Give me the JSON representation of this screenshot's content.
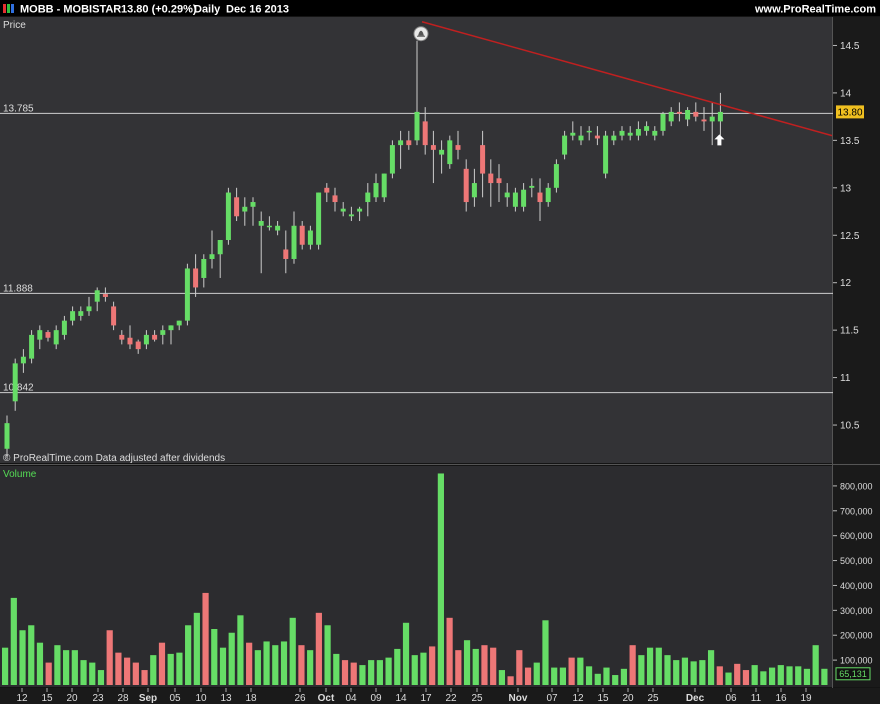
{
  "header": {
    "symbol": "MOBB - MOBISTAR",
    "quote": "13.80 (+0.29%)",
    "period": "Daily",
    "date": "Dec 16 2013",
    "site": "www.ProRealTime.com"
  },
  "price_panel": {
    "label": "Price",
    "credit": "© ProRealTime.com  Data adjusted after dividends",
    "last_price_badge": "13.80",
    "hlines": [
      {
        "label": "13.785",
        "value": 13.785
      },
      {
        "label": "11.888",
        "value": 11.888
      },
      {
        "label": "10.842",
        "value": 10.842
      }
    ],
    "trendline": {
      "from": {
        "date": "Oct 18",
        "price": 14.75
      },
      "to": {
        "date": "Dec 19",
        "price": 13.55
      }
    }
  },
  "volume_panel": {
    "label": "Volume",
    "last_volume_badge": "65,131"
  },
  "colors": {
    "up": "#66dd66",
    "down": "#ee7777",
    "trendline": "#c02020",
    "badge": "#f0c020"
  },
  "chart_data": [
    {
      "type": "candlestick",
      "title": "MOBB - MOBISTAR",
      "ylabel": "Price",
      "ylim": [
        10.1,
        14.8
      ],
      "yticks": [
        10.5,
        11,
        11.5,
        12,
        12.5,
        13,
        13.5,
        14,
        14.5
      ],
      "xticks": [
        "12",
        "15",
        "20",
        "23",
        "28",
        "Sep",
        "05",
        "10",
        "13",
        "18",
        "26",
        "Oct",
        "04",
        "09",
        "14",
        "17",
        "22",
        "25",
        "Nov",
        "07",
        "12",
        "15",
        "20",
        "25",
        "Dec",
        "06",
        "11",
        "16",
        "19"
      ],
      "ohlc": [
        [
          10.25,
          10.6,
          10.15,
          10.52
        ],
        [
          10.75,
          11.2,
          10.65,
          11.15
        ],
        [
          11.15,
          11.3,
          11.05,
          11.22
        ],
        [
          11.2,
          11.5,
          11.15,
          11.45
        ],
        [
          11.4,
          11.55,
          11.3,
          11.5
        ],
        [
          11.48,
          11.5,
          11.38,
          11.42
        ],
        [
          11.35,
          11.55,
          11.3,
          11.5
        ],
        [
          11.45,
          11.65,
          11.4,
          11.6
        ],
        [
          11.6,
          11.75,
          11.55,
          11.7
        ],
        [
          11.65,
          11.75,
          11.6,
          11.7
        ],
        [
          11.7,
          11.85,
          11.65,
          11.75
        ],
        [
          11.8,
          11.95,
          11.7,
          11.92
        ],
        [
          11.88,
          11.95,
          11.8,
          11.85
        ],
        [
          11.75,
          11.8,
          11.5,
          11.55
        ],
        [
          11.45,
          11.5,
          11.35,
          11.4
        ],
        [
          11.42,
          11.55,
          11.3,
          11.35
        ],
        [
          11.38,
          11.4,
          11.25,
          11.3
        ],
        [
          11.35,
          11.5,
          11.3,
          11.45
        ],
        [
          11.45,
          11.5,
          11.38,
          11.4
        ],
        [
          11.45,
          11.55,
          11.35,
          11.5
        ],
        [
          11.5,
          11.55,
          11.35,
          11.55
        ],
        [
          11.55,
          11.6,
          11.5,
          11.6
        ],
        [
          11.6,
          12.2,
          11.55,
          12.15
        ],
        [
          12.15,
          12.3,
          11.85,
          11.95
        ],
        [
          12.05,
          12.3,
          11.95,
          12.25
        ],
        [
          12.25,
          12.55,
          12.15,
          12.3
        ],
        [
          12.3,
          12.45,
          12.05,
          12.45
        ],
        [
          12.45,
          13.0,
          12.4,
          12.95
        ],
        [
          12.9,
          13.0,
          12.65,
          12.7
        ],
        [
          12.75,
          12.9,
          12.6,
          12.8
        ],
        [
          12.8,
          12.9,
          12.6,
          12.85
        ],
        [
          12.6,
          12.75,
          12.1,
          12.65
        ],
        [
          12.6,
          12.7,
          12.55,
          12.6
        ],
        [
          12.55,
          12.65,
          12.5,
          12.6
        ],
        [
          12.35,
          12.55,
          12.1,
          12.25
        ],
        [
          12.25,
          12.75,
          12.2,
          12.6
        ],
        [
          12.6,
          12.65,
          12.35,
          12.4
        ],
        [
          12.4,
          12.6,
          12.35,
          12.55
        ],
        [
          12.4,
          12.95,
          12.35,
          12.95
        ],
        [
          13.0,
          13.05,
          12.85,
          12.95
        ],
        [
          12.92,
          13.0,
          12.75,
          12.85
        ],
        [
          12.75,
          12.85,
          12.7,
          12.78
        ],
        [
          12.7,
          12.8,
          12.65,
          12.72
        ],
        [
          12.75,
          12.8,
          12.65,
          12.78
        ],
        [
          12.85,
          13.05,
          12.7,
          12.95
        ],
        [
          12.9,
          13.15,
          12.85,
          13.05
        ],
        [
          12.9,
          13.15,
          12.85,
          13.15
        ],
        [
          13.15,
          13.5,
          13.1,
          13.45
        ],
        [
          13.45,
          13.6,
          13.2,
          13.5
        ],
        [
          13.5,
          13.6,
          13.4,
          13.45
        ],
        [
          13.5,
          14.55,
          13.45,
          13.8
        ],
        [
          13.7,
          13.85,
          13.35,
          13.45
        ],
        [
          13.45,
          13.6,
          13.05,
          13.4
        ],
        [
          13.35,
          13.5,
          13.15,
          13.4
        ],
        [
          13.25,
          13.55,
          13.2,
          13.5
        ],
        [
          13.45,
          13.6,
          13.3,
          13.4
        ],
        [
          13.2,
          13.3,
          12.75,
          12.85
        ],
        [
          12.9,
          13.2,
          12.8,
          13.05
        ],
        [
          13.45,
          13.6,
          12.9,
          13.15
        ],
        [
          13.15,
          13.3,
          12.8,
          13.05
        ],
        [
          13.1,
          13.25,
          12.85,
          13.05
        ],
        [
          12.9,
          13.05,
          12.8,
          12.95
        ],
        [
          12.8,
          13.0,
          12.75,
          12.95
        ],
        [
          12.8,
          13.05,
          12.75,
          12.98
        ],
        [
          13.0,
          13.1,
          12.9,
          13.02
        ],
        [
          12.95,
          13.1,
          12.65,
          12.85
        ],
        [
          12.85,
          13.05,
          12.8,
          13.0
        ],
        [
          13.0,
          13.3,
          12.95,
          13.25
        ],
        [
          13.35,
          13.6,
          13.3,
          13.55
        ],
        [
          13.55,
          13.7,
          13.5,
          13.58
        ],
        [
          13.5,
          13.65,
          13.45,
          13.55
        ],
        [
          13.6,
          13.65,
          13.5,
          13.6
        ],
        [
          13.55,
          13.65,
          13.45,
          13.52
        ],
        [
          13.15,
          13.6,
          13.1,
          13.55
        ],
        [
          13.5,
          13.6,
          13.45,
          13.55
        ],
        [
          13.55,
          13.65,
          13.5,
          13.6
        ],
        [
          13.55,
          13.65,
          13.5,
          13.58
        ],
        [
          13.55,
          13.7,
          13.5,
          13.62
        ],
        [
          13.6,
          13.7,
          13.55,
          13.65
        ],
        [
          13.55,
          13.65,
          13.5,
          13.6
        ],
        [
          13.6,
          13.8,
          13.55,
          13.78
        ],
        [
          13.7,
          13.85,
          13.65,
          13.8
        ],
        [
          13.8,
          13.9,
          13.7,
          13.78
        ],
        [
          13.72,
          13.85,
          13.65,
          13.82
        ],
        [
          13.8,
          13.9,
          13.7,
          13.75
        ],
        [
          13.72,
          13.85,
          13.6,
          13.7
        ],
        [
          13.7,
          13.9,
          13.45,
          13.75
        ],
        [
          13.7,
          14.0,
          13.55,
          13.8
        ]
      ]
    },
    {
      "type": "bar",
      "title": "Volume",
      "ylim": [
        0,
        880000
      ],
      "yticks": [
        100000,
        200000,
        300000,
        400000,
        500000,
        600000,
        700000,
        800000
      ],
      "ytick_labels": [
        "100,000",
        "200,000",
        "300,000",
        "400,000",
        "500,000",
        "600,000",
        "700,000",
        "800,000"
      ],
      "values": [
        150000,
        350000,
        220000,
        240000,
        170000,
        90000,
        160000,
        140000,
        140000,
        100000,
        90000,
        60000,
        220000,
        130000,
        110000,
        90000,
        60000,
        120000,
        170000,
        125000,
        130000,
        240000,
        290000,
        370000,
        225000,
        150000,
        210000,
        280000,
        170000,
        140000,
        175000,
        160000,
        175000,
        270000,
        160000,
        140000,
        290000,
        240000,
        125000,
        100000,
        90000,
        80000,
        100000,
        100000,
        110000,
        145000,
        250000,
        120000,
        130000,
        155000,
        850000,
        270000,
        140000,
        180000,
        145000,
        160000,
        150000,
        60000,
        35000,
        140000,
        70000,
        90000,
        260000,
        70000,
        70000,
        110000,
        110000,
        75000,
        45000,
        70000,
        40000,
        65000,
        160000,
        120000,
        150000,
        150000,
        120000,
        100000,
        110000,
        95000,
        100000,
        140000,
        75000,
        50000,
        85000,
        60000,
        80000,
        55000,
        70000,
        80000,
        75000,
        75000,
        65000,
        160000,
        65131
      ]
    }
  ]
}
